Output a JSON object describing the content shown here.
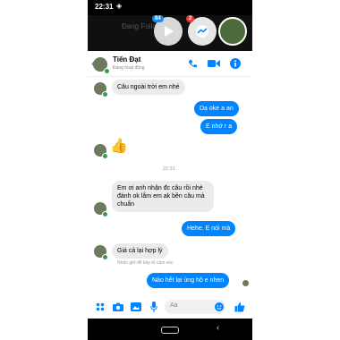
{
  "status_bar": {
    "time": "22:31"
  },
  "background_title": "Đang Follow",
  "chat_heads": [
    {
      "badge": "84"
    },
    {
      "badge": "2"
    }
  ],
  "header": {
    "name": "Tiến Đạt",
    "status": "Đang hoạt động"
  },
  "messages": [
    {
      "direction": "in",
      "text": "Câu ngoài trời em nhé"
    },
    {
      "direction": "out",
      "text": "Dạ oke a an"
    },
    {
      "direction": "out",
      "text": "E nhớ r a"
    },
    {
      "direction": "in",
      "text": "👍"
    },
    {
      "direction": "in",
      "text": "Em ơi anh nhận đc câu rồi nhé đánh ok lắm em ak bền câu mà chuẩn"
    },
    {
      "direction": "out",
      "text": "Hehe. E nói mà"
    },
    {
      "direction": "in",
      "text": "Giá cả lại hợp lý"
    },
    {
      "direction": "out",
      "text": "Nào hết lại ủng hộ e nhen"
    }
  ],
  "time_separator": "22:31",
  "reply_hint": "Nhấn giữ để bày tỏ cảm xúc",
  "composer": {
    "placeholder": "Aa"
  },
  "colors": {
    "accent": "#0084ff",
    "incoming_bubble": "#ebebeb",
    "online": "#31a24c"
  }
}
